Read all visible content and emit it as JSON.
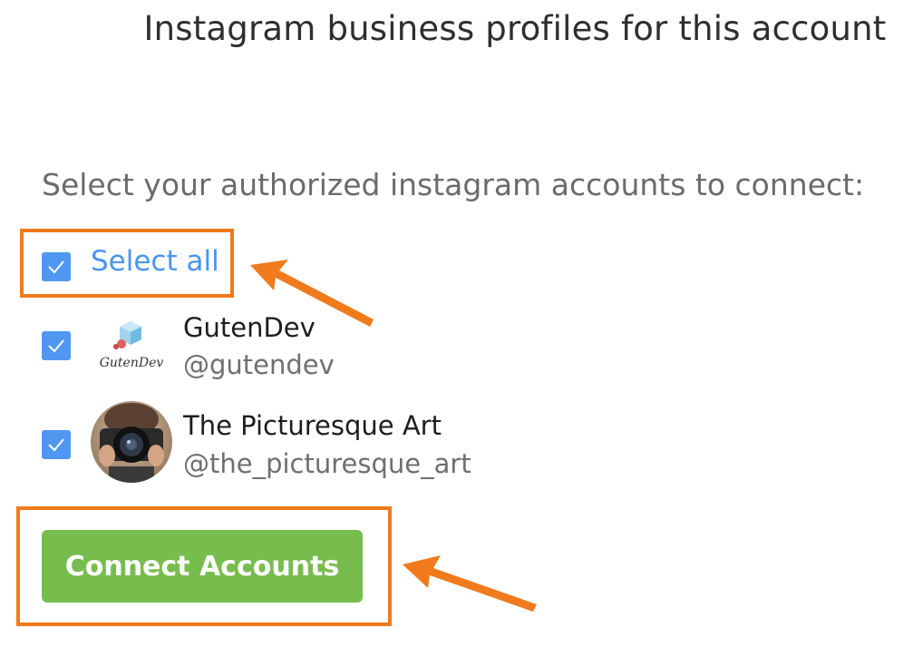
{
  "header": {
    "title": "Instagram business profiles for this account"
  },
  "prompt_text": "Select your authorized instagram accounts to connect:",
  "select_all": {
    "label": "Select all",
    "checked": true
  },
  "accounts": [
    {
      "name": "GutenDev",
      "handle": "@gutendev",
      "checked": true,
      "avatar": "gutendev-logo",
      "logo_text": "GutenDev"
    },
    {
      "name": "The Picturesque Art",
      "handle": "@the_picturesque_art",
      "checked": true,
      "avatar": "camera-photo"
    }
  ],
  "connect_button": {
    "label": "Connect Accounts"
  },
  "colors": {
    "checkbox": "#4f98f2",
    "select_all_text": "#4a95f0",
    "button": "#77bd4e",
    "highlight": "#f07a1c"
  }
}
